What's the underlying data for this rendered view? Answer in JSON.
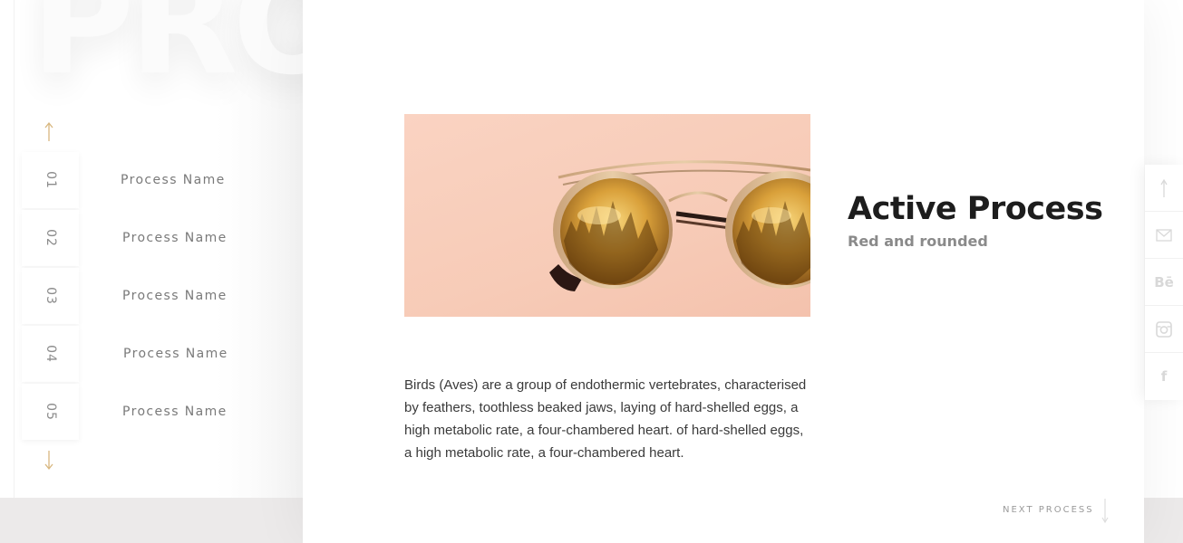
{
  "background_word": "PROCESS",
  "processes": [
    {
      "number": "01",
      "name": "Process Name"
    },
    {
      "number": "02",
      "name": "Process Name"
    },
    {
      "number": "03",
      "name": "Process Name"
    },
    {
      "number": "04",
      "name": "Process Name"
    },
    {
      "number": "05",
      "name": "Process Name"
    }
  ],
  "active": {
    "title": "Active Process",
    "subtitle": "Red and rounded",
    "description": "Birds (Aves) are a group of endothermic vertebrates, characterised by feathers, toothless beaked jaws, laying of hard-shelled eggs, a high metabolic rate, a four-chambered heart. of hard-shelled eggs, a high metabolic rate, a four-chambered heart."
  },
  "next": {
    "label": "NEXT PROCESS"
  },
  "social": {
    "behance_label": "Bē",
    "facebook_label": "f"
  },
  "icons": {
    "up": "arrow-up-icon",
    "down": "arrow-down-icon",
    "share": "arrow-up-icon",
    "mail": "mail-icon",
    "behance": "behance-icon",
    "instagram": "instagram-icon",
    "facebook": "facebook-icon"
  },
  "colors": {
    "accent": "#d8b77f",
    "title": "#1d1d1d",
    "subtitle": "#8a8a8a",
    "photo_background": "#f8cdb9"
  }
}
